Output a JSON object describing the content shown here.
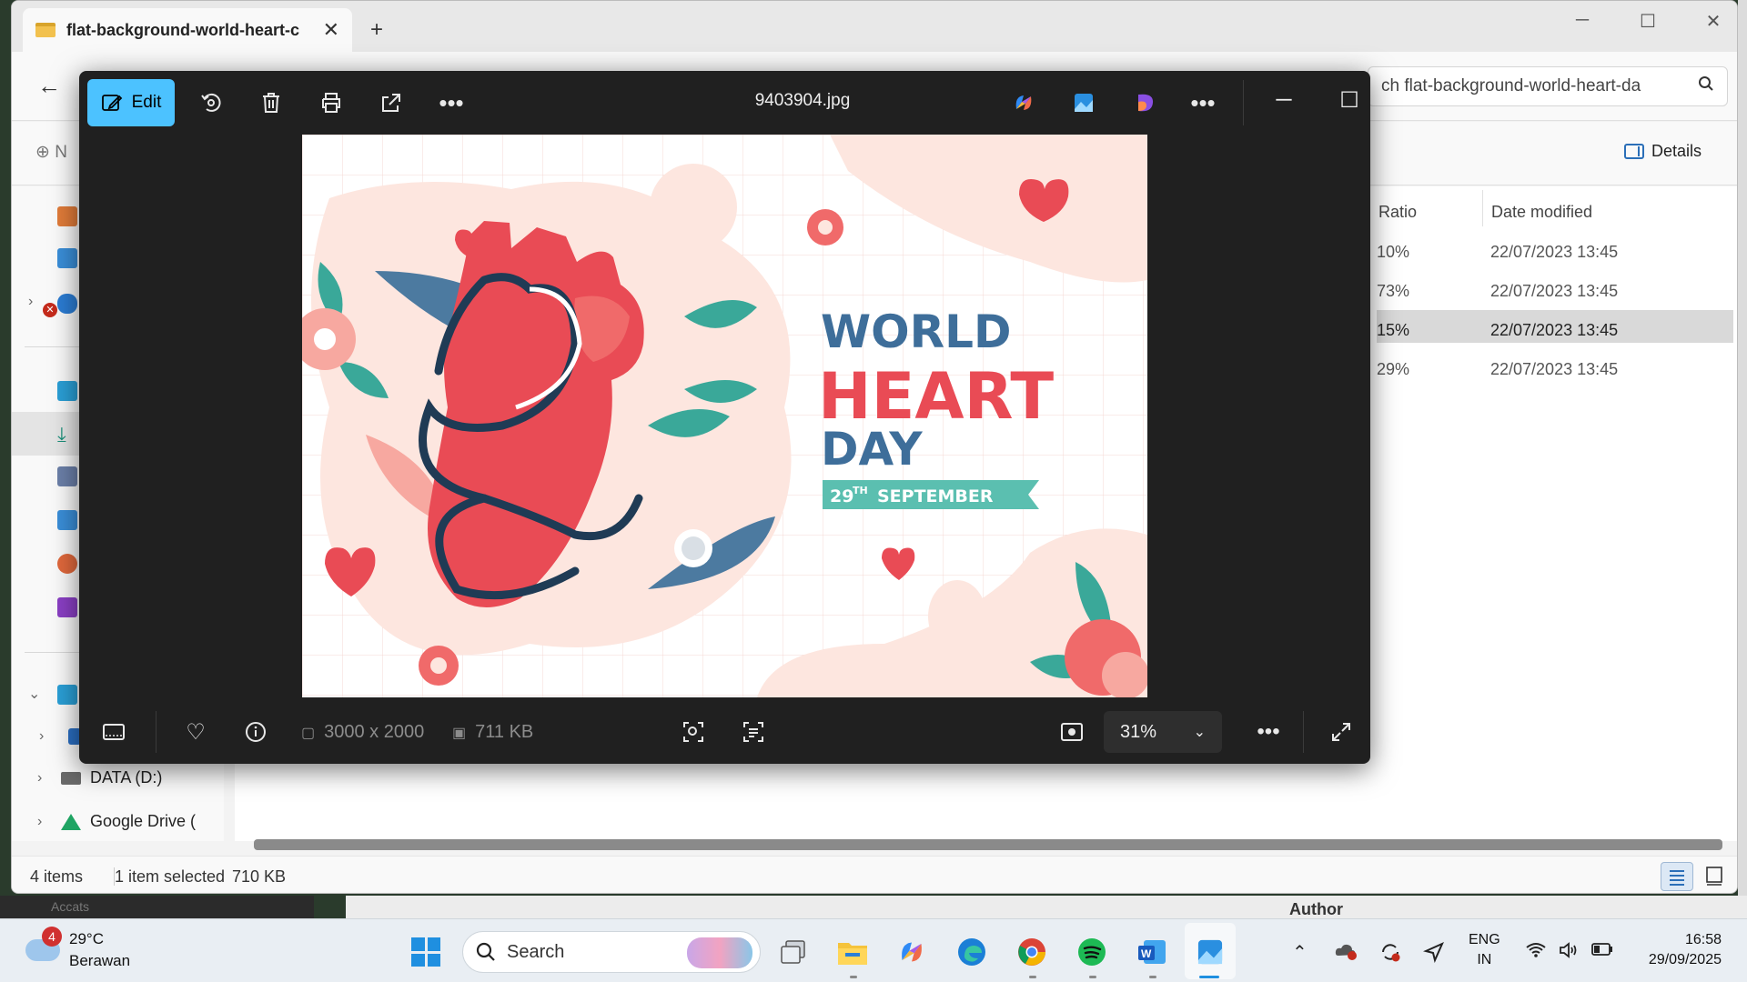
{
  "explorer": {
    "tab_title": "flat-background-world-heart-c",
    "search_text": "ch flat-background-world-heart-da",
    "new_label": "N",
    "details_label": "Details",
    "columns": [
      "Ratio",
      "Date modified"
    ],
    "rows": [
      {
        "ratio": "10%",
        "date": "22/07/2023 13:45"
      },
      {
        "ratio": "73%",
        "date": "22/07/2023 13:45"
      },
      {
        "ratio": "15%",
        "date": "22/07/2023 13:45"
      },
      {
        "ratio": "29%",
        "date": "22/07/2023 13:45"
      }
    ],
    "sidebar": {
      "data_drive": "DATA (D:)",
      "google_drive": "Google Drive ("
    },
    "status": {
      "item_count": "4 items",
      "selection": "1 item selected",
      "selection_size": "710 KB"
    }
  },
  "behind": {
    "author_label": "Author",
    "left_label": "Accats"
  },
  "photos": {
    "edit_label": "Edit",
    "file_name": "9403904.jpg",
    "dimensions": "3000 x 2000",
    "file_size": "711 KB",
    "zoom": "31%",
    "image": {
      "line1": "WORLD",
      "line2": "HEART",
      "line3": "DAY",
      "date_number": "29",
      "date_suffix": "TH",
      "date_month": "SEPTEMBER"
    }
  },
  "taskbar": {
    "weather_badge": "4",
    "temperature": "29°C",
    "weather_desc": "Berawan",
    "search_placeholder": "Search",
    "lang_line1": "ENG",
    "lang_line2": "IN",
    "time": "16:58",
    "date": "29/09/2025"
  },
  "colors": {
    "edit_accent": "#4cc2ff",
    "heart_red": "#e94b55",
    "title_blue": "#3e6e9a",
    "ribbon_teal": "#5bbfb0"
  }
}
